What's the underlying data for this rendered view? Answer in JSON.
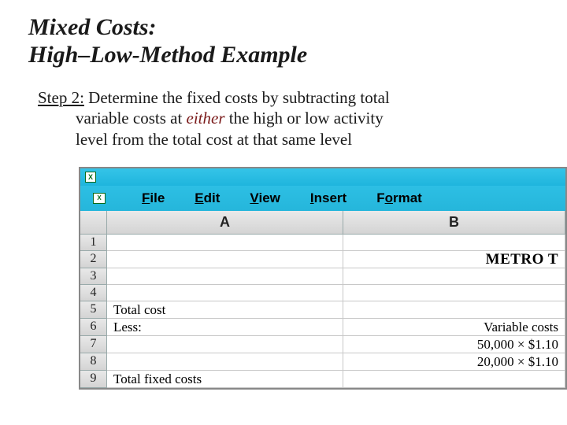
{
  "title_line1": "Mixed Costs:",
  "title_line2": "High–Low-Method Example",
  "step_label": "Step 2:",
  "body_part1": "  Determine the fixed costs by subtracting total",
  "body_line2": "variable costs at ",
  "either": "either",
  "body_line2b": " the high or low activity",
  "body_line3": "level from the total cost at that same level",
  "menu": {
    "file": "File",
    "edit": "Edit",
    "view": "View",
    "insert": "Insert",
    "format": "Format"
  },
  "columns": {
    "A": "A",
    "B": "B"
  },
  "rows": {
    "r1": "1",
    "r2": "2",
    "r3": "3",
    "r4": "4",
    "r5": "5",
    "r6": "6",
    "r7": "7",
    "r8": "8",
    "r9": "9"
  },
  "cells": {
    "b2": "METRO T",
    "a5": "Total cost",
    "a6": "Less:",
    "b6": "Variable costs",
    "b7": "50,000 × $1.10",
    "b8": "20,000 × $1.10",
    "a9": "Total fixed costs"
  },
  "xl_icon": "X"
}
